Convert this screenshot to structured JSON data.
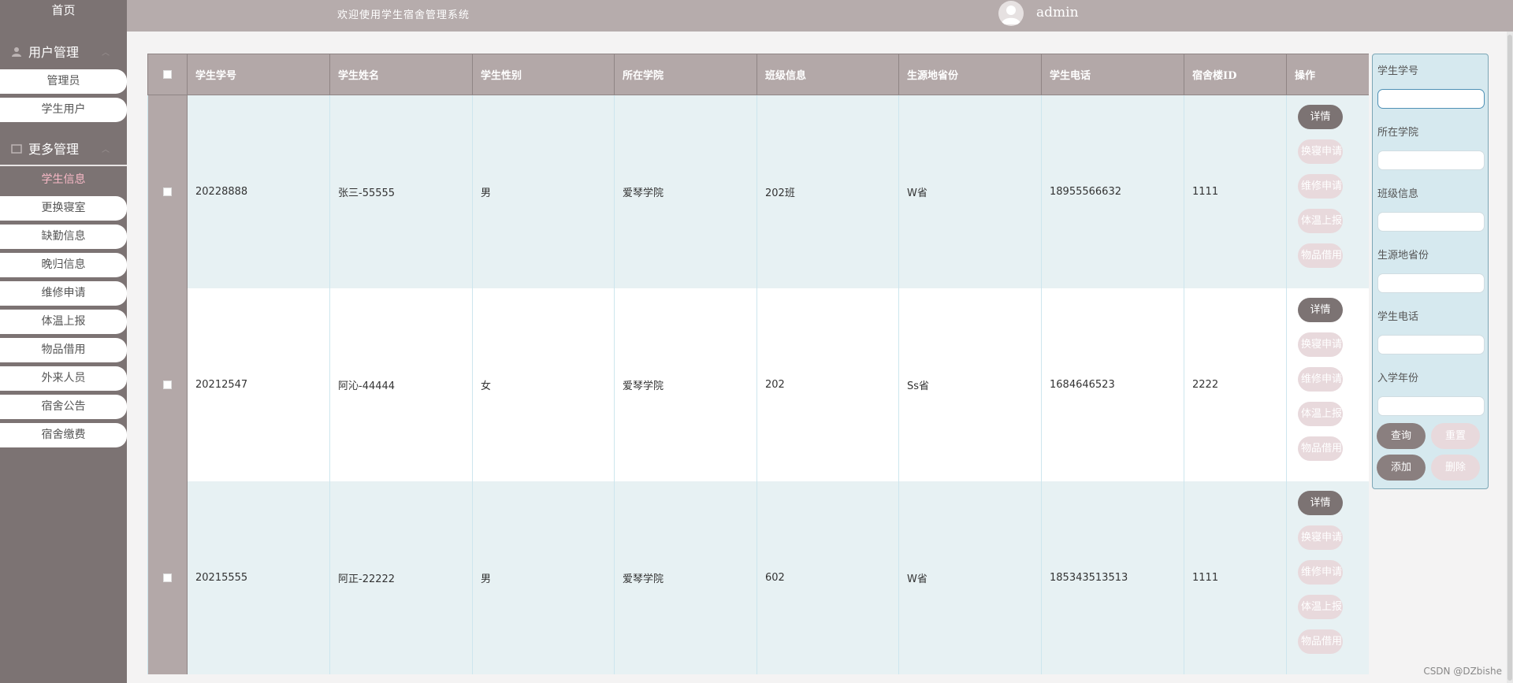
{
  "sidebar": {
    "home": "首页",
    "groups": [
      {
        "label": "用户管理",
        "icon": "user-icon"
      },
      {
        "label": "更多管理",
        "icon": "grid-icon"
      }
    ],
    "user_items": [
      "管理员",
      "学生用户"
    ],
    "more_items": [
      "学生信息",
      "更换寝室",
      "缺勤信息",
      "晚归信息",
      "维修申请",
      "体温上报",
      "物品借用",
      "外来人员",
      "宿舍公告",
      "宿舍缴费"
    ],
    "active_item": "学生信息"
  },
  "topbar": {
    "welcome": "欢迎使用学生宿舍管理系统",
    "username": "admin"
  },
  "table": {
    "headers": [
      "学生学号",
      "学生姓名",
      "学生性别",
      "所在学院",
      "班级信息",
      "生源地省份",
      "学生电话",
      "宿舍楼ID",
      "操作"
    ],
    "rows": [
      [
        "20228888",
        "张三-55555",
        "男",
        "爱琴学院",
        "202班",
        "W省",
        "18955566632",
        "1111"
      ],
      [
        "20212547",
        "阿沁-44444",
        "女",
        "爱琴学院",
        "202",
        "Ss省",
        "1684646523",
        "2222"
      ],
      [
        "20215555",
        "阿正-22222",
        "男",
        "爱琴学院",
        "602",
        "W省",
        "185343513513",
        "1111"
      ]
    ],
    "ops": [
      "详情",
      "换寝申请",
      "维修申请",
      "体温上报",
      "物品借用"
    ]
  },
  "search": {
    "fields": [
      "学生学号",
      "所在学院",
      "班级信息",
      "生源地省份",
      "学生电话",
      "入学年份"
    ],
    "buttons": {
      "query": "查询",
      "reset": "重置",
      "add": "添加",
      "delete": "删除"
    }
  },
  "watermark": "CSDN @DZbishe"
}
